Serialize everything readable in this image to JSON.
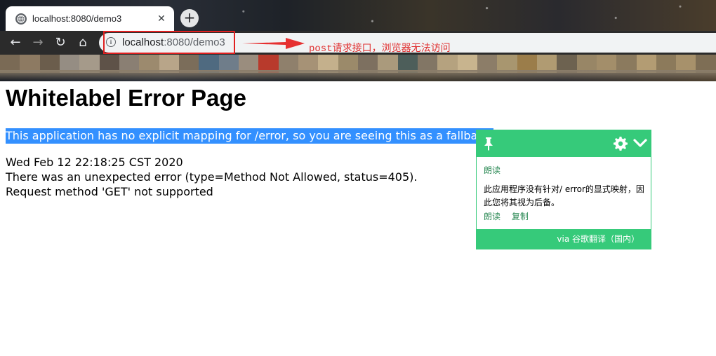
{
  "browser": {
    "tab_title": "localhost:8080/demo3",
    "tab_close_glyph": "✕",
    "new_tab_glyph": "+",
    "url_host": "localhost",
    "url_path": ":8080/demo3",
    "nav": {
      "back_glyph": "←",
      "forward_glyph": "→",
      "reload_glyph": "↻",
      "home_glyph": "⌂"
    },
    "info_glyph": "i",
    "icons": [
      "globe-icon",
      "close-icon",
      "plus-icon",
      "back-arrow-icon",
      "forward-arrow-icon",
      "reload-icon",
      "home-icon",
      "info-icon"
    ]
  },
  "annotation": {
    "text": "post请求接口，浏览器无法访问",
    "color": "#e03030"
  },
  "page": {
    "title": "Whitelabel Error Page",
    "fallback": "This application has no explicit mapping for /error, so you are seeing this as a fallback.",
    "timestamp": "Wed Feb 12 22:18:25 CST 2020",
    "error": "There was an unexpected error (type=Method Not Allowed, status=405).",
    "method": "Request method 'GET' not supported"
  },
  "translate_popup": {
    "read_label": "朗读",
    "translation": "此应用程序没有针对/ error的显式映射，因此您将其视为后备。",
    "action_read": "朗读",
    "action_copy": "复制",
    "footer": "via 谷歌翻译（国内）",
    "accent_color": "#36ca7a",
    "icons": [
      "pin-icon",
      "gear-icon",
      "chevron-down-icon"
    ]
  },
  "colors": {
    "selection": "#3390ff",
    "highlight_box": "#e02020"
  }
}
